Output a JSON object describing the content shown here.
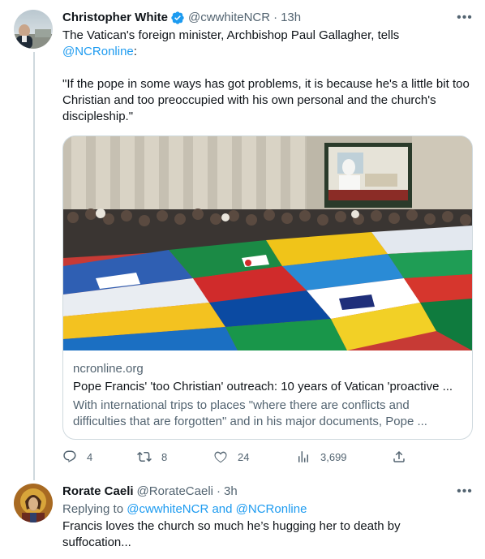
{
  "tweet1": {
    "author_name": "Christopher White",
    "handle": "@cwwhiteNCR",
    "time": "13h",
    "text_line1": "The Vatican's foreign minister, Archbishop Paul Gallagher, tells",
    "mention": "@NCRonline",
    "text_after_mention": ":",
    "quote": "\"If the pope in some ways has got problems, it is because he's a little bit too Christian and too preoccupied with his own personal and the church's discipleship.\"",
    "card": {
      "domain": "ncronline.org",
      "title": "Pope Francis' 'too Christian' outreach: 10 years of Vatican 'proactive ...",
      "description": "With international trips to places \"where there are conflicts and difficulties that are forgotten\" and in his major documents, Pope ..."
    },
    "actions": {
      "replies": "4",
      "retweets": "8",
      "likes": "24",
      "views": "3,699"
    },
    "colors": {
      "verified": "#1d9bf0",
      "link": "#1d9bf0"
    }
  },
  "tweet2": {
    "author_name": "Rorate Caeli",
    "handle": "@RorateCaeli",
    "time": "3h",
    "replying_prefix": "Replying to",
    "replying_to": "@cwwhiteNCR and @NCRonline",
    "text": "Francis loves the church so much he’s hugging her to death by suffocation..."
  }
}
